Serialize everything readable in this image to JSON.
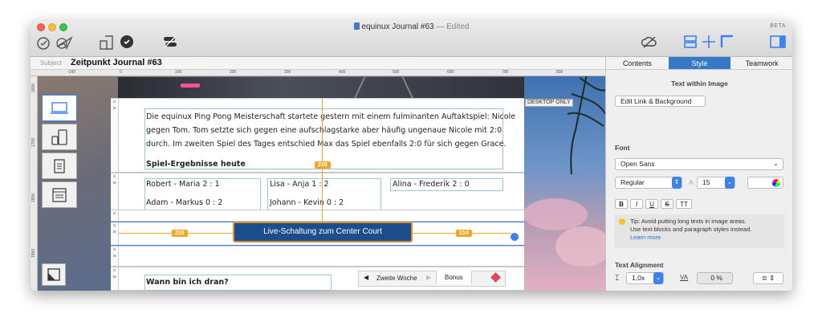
{
  "window": {
    "title": "equinux Journal #63",
    "title_suffix": "— Edited",
    "beta": "BETA"
  },
  "subject": {
    "label": "Subject",
    "value": "Zeitpunkt Journal #63"
  },
  "ruler": {
    "h_ticks": [
      "-100",
      "0",
      "100",
      "200",
      "300",
      "400",
      "500",
      "600",
      "700",
      "800"
    ],
    "v_ticks": [
      "1600",
      "1700",
      "1800",
      "1900"
    ]
  },
  "canvas": {
    "desktop_only": "DESKTOP ONLY",
    "paragraph": [
      "Die equinux Ping Pong Meisterschaft startete gestern mit einem fulminanten Auftaktspiel: Nicole",
      "gegen Tom. Tom setzte sich gegen eine aufschlagstarke aber häufig ungenaue Nicole mit 2:0",
      "durch. Im zweiten Spiel des Tages entschied Max das Spiel ebenfalls 2:0 für sich gegen Grace."
    ],
    "results_heading": "Spiel-Ergebnisse heute",
    "results": [
      [
        "Robert - Maria 2 : 1",
        "Lisa - Anja   1 : 2",
        "Alina - Frederik   2 : 0"
      ],
      [
        "Adam - Markus 0 : 2",
        "Johann - Kevin 0 : 2",
        ""
      ]
    ],
    "live_button": "Live-Schaltung zum Center Court",
    "measure": {
      "top": "238",
      "left": "216",
      "right": "214"
    },
    "question": "Wann bin ich dran?",
    "week_nav": {
      "label": "Zweite Woche",
      "bonus": "Bonus"
    }
  },
  "inspector": {
    "tabs": [
      "Contents",
      "Style",
      "Teamwork"
    ],
    "active_tab": "Style",
    "section_title": "Text within Image",
    "edit_link_button": "Edit Link & Background",
    "font_label": "Font",
    "font_family": "Open Sans",
    "font_style": "Regular",
    "font_size": "15",
    "style_buttons": [
      "B",
      "I",
      "U",
      "S",
      "TT"
    ],
    "tip": "Tip: Avoid putting long texts in image areas. Use text blocks and paragraph styles instead.",
    "tip_line1": "Tip: Avoid putting long texts in image areas.",
    "tip_line2": "Use text blocks and paragraph styles instead.",
    "learn_more": "Learn more",
    "alignment_label": "Text Alignment",
    "line_height": "1,0x",
    "tracking_label": "VA",
    "tracking_value": "0 %"
  },
  "colors": {
    "accent": "#3478c6",
    "live_blue": "#1d4e8c",
    "measure_orange": "#f5a623"
  }
}
